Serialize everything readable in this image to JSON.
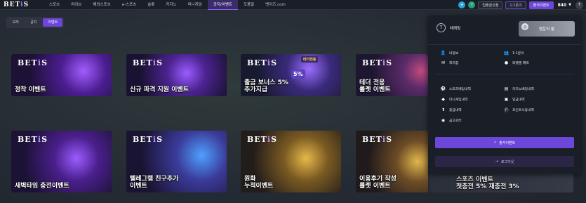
{
  "brand": {
    "pre": "BET",
    "i": "i",
    "post": "S"
  },
  "nav": [
    "스포츠",
    "라이브",
    "해외스포츠",
    "e-스포츠",
    "슬롯",
    "카지노",
    "미니게임",
    "공지/이벤트",
    "도움말",
    "벳이즈.com"
  ],
  "nav_active_index": 7,
  "topright": {
    "telegram_icon": "telegram-icon",
    "t_icon": "T",
    "btn_deposit": "입출금신청",
    "btn_inquiry": "1:1문의",
    "btn_attendance": "출석이벤트",
    "points": "840",
    "avatar": "T"
  },
  "tabs": [
    "모두",
    "공지",
    "이벤트"
  ],
  "tab_active_index": 2,
  "cards": [
    {
      "title": "정착 이벤트",
      "has_brand": true,
      "yellow": false
    },
    {
      "title": "신규 파격 지원 이벤트",
      "has_brand": true,
      "yellow": false
    },
    {
      "title": "출금 보너스 5%\n추가지급",
      "has_brand": true,
      "yellow": false,
      "badge": "테더전용",
      "pct": "5%"
    },
    {
      "title": "테더 전용\n룰렛 이벤트",
      "has_brand": true,
      "yellow": false
    },
    {
      "title": "새벽타임 충전이벤트",
      "has_brand": true,
      "yellow": false
    },
    {
      "title": "텔레그램 친구추가\n이벤트",
      "has_brand": true,
      "yellow": false
    },
    {
      "title": "원화\n누적이벤트",
      "has_brand": true,
      "yellow": false
    },
    {
      "title": "이용후기 작성\n룰렛 이벤트",
      "has_brand": true,
      "yellow": false
    },
    {
      "title": "스포츠 이벤트\n첫충전 5% 재충전 3%",
      "has_brand": false,
      "yellow": false
    }
  ],
  "panel": {
    "user_initial": "T",
    "username": "테케링",
    "attendance_btn": "행운의 휠",
    "menu_a": [
      {
        "icon": "user-icon",
        "label": "내정보"
      },
      {
        "icon": "users-icon",
        "label": "1:1문의"
      },
      {
        "icon": "mail-icon",
        "label": "쪽지함"
      },
      {
        "icon": "coin-icon",
        "label": "레벨별 혜택"
      }
    ],
    "menu_b": [
      {
        "icon": "ball-icon",
        "label": "스포츠배팅내역"
      },
      {
        "icon": "cards-icon",
        "label": "카지노배팅내역"
      },
      {
        "icon": "game-icon",
        "label": "미니게임내역"
      },
      {
        "icon": "wallet-icon",
        "label": "입금내역"
      },
      {
        "icon": "withdraw-icon",
        "label": "출금내역"
      },
      {
        "icon": "point-icon",
        "label": "포인트사용내역"
      },
      {
        "icon": "coupon-icon",
        "label": "금고관리"
      }
    ],
    "event_btn": "출석이벤트",
    "logout_btn": "로그아웃"
  },
  "colors": {
    "accent": "#6c47d9",
    "bg": "#262c36",
    "panel": "#1a1e27"
  }
}
